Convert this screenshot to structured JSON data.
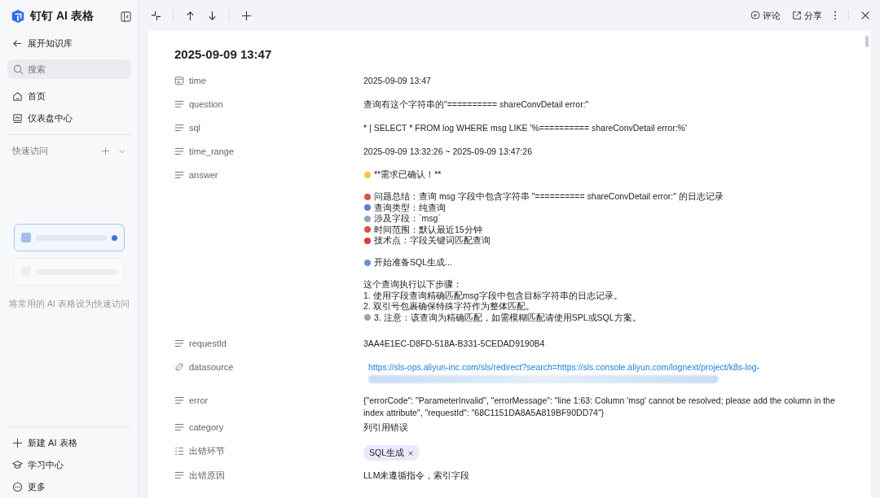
{
  "sidebar": {
    "app_name": "钉钉 AI 表格",
    "back_label": "展开知识库",
    "search": {
      "placeholder": "搜索"
    },
    "nav": [
      {
        "label": "首页"
      },
      {
        "label": "仪表盘中心"
      }
    ],
    "quick_access": {
      "title": "快速访问",
      "hint": "将常用的 AI 表格设为快速访问"
    },
    "footer": [
      {
        "label": "新建 AI 表格"
      },
      {
        "label": "学习中心"
      },
      {
        "label": "更多"
      }
    ]
  },
  "toolbar": {
    "comment": "评论",
    "share": "分享"
  },
  "record": {
    "title": "2025-09-09 13:47",
    "fields": [
      {
        "label": "time",
        "kind": "datetime",
        "value": "2025-09-09 13:47"
      },
      {
        "label": "question",
        "kind": "text",
        "value": "查询有这个字符串的\"========== shareConvDetail error:\""
      },
      {
        "label": "sql",
        "kind": "text",
        "value": "* | SELECT * FROM log WHERE msg LIKE '%========== shareConvDetail error:%'"
      },
      {
        "label": "time_range",
        "kind": "text",
        "value": "2025-09-09 13:32:26 ~ 2025-09-09 13:47:26"
      },
      {
        "label": "answer",
        "kind": "longtext",
        "lines": [
          {
            "kind": "sparkle",
            "text": "**需求已确认！**"
          },
          {
            "kind": "blank"
          },
          {
            "kind": "target",
            "text": "问题总结：查询 msg 字段中包含字符串 \"========== shareConvDetail error:\" 的日志记录"
          },
          {
            "kind": "search",
            "text": "查询类型：纯查询"
          },
          {
            "kind": "card",
            "text": "涉及字段：`msg`"
          },
          {
            "kind": "clock",
            "text": "时间范围：默认最近15分钟"
          },
          {
            "kind": "pin",
            "text": "技术点：字段关键词匹配查询"
          },
          {
            "kind": "blank"
          },
          {
            "kind": "rocket",
            "text": "开始准备SQL生成..."
          },
          {
            "kind": "blank"
          },
          {
            "kind": "plain",
            "text": "这个查询执行以下步骤："
          },
          {
            "kind": "plain",
            "text": "1. 使用字段查询精确匹配msg字段中包含目标字符串的日志记录。"
          },
          {
            "kind": "plain",
            "text": "2. 双引号包裹确保特殊字符作为整体匹配。"
          },
          {
            "kind": "flag",
            "text": "3. 注意：该查询为精确匹配，如需模糊匹配请使用SPL或SQL方案。"
          }
        ]
      },
      {
        "label": "requestId",
        "kind": "text",
        "value": "3AA4E1EC-D8FD-518A-B331-5CEDAD9190B4"
      },
      {
        "label": "datasource",
        "kind": "link",
        "value": "https://sls-ops.aliyun-inc.com/sls/redirect?search=https://sls.console.aliyun.com/lognext/project/k8s-log-"
      },
      {
        "label": "error",
        "kind": "text",
        "value": "{\"errorCode\": \"ParameterInvalid\", \"errorMessage\": \"line 1:63: Column 'msg' cannot be resolved; please add the column in the index attribute\", \"requestId\": \"68C1151DA8A5A819BF90DD74\"}"
      },
      {
        "label": "category",
        "kind": "text",
        "value": "列引用错误"
      },
      {
        "label": "出错环节",
        "kind": "tags",
        "tags": [
          "SQL生成"
        ]
      },
      {
        "label": "出错原因",
        "kind": "text",
        "value": "LLM未遵循指令，索引字段"
      }
    ]
  }
}
